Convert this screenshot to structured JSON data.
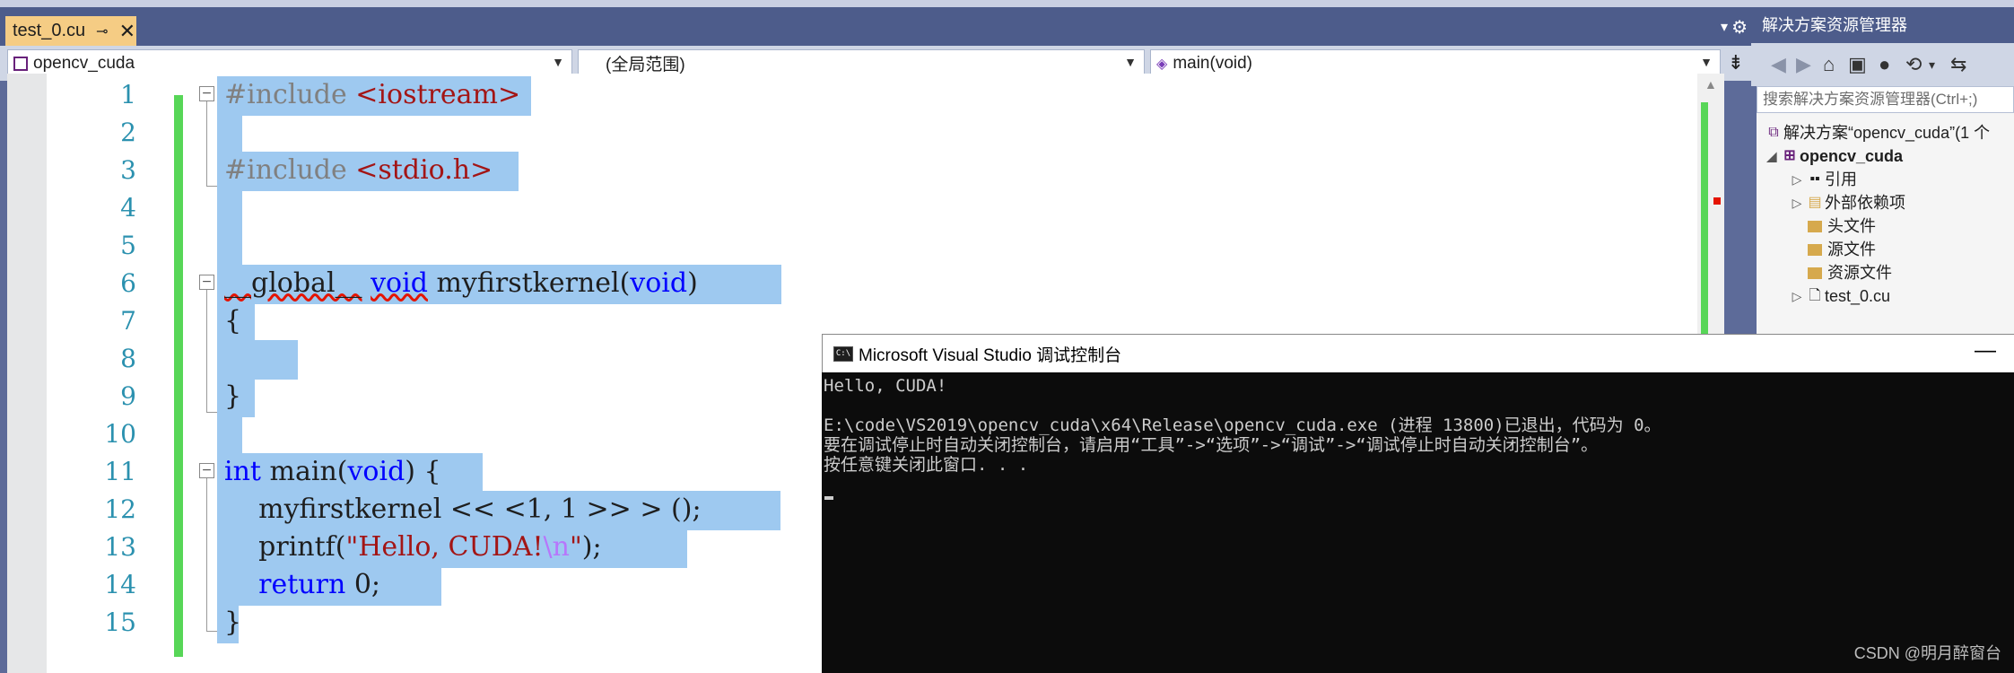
{
  "document_tab": {
    "title": "test_0.cu",
    "pin_icon": "pin-icon",
    "close": "✕"
  },
  "tabbar": {
    "dropdown": "▾",
    "settings": "⚙"
  },
  "navigation": {
    "project_combo": "opencv_cuda",
    "scope_combo": "(全局范围)",
    "member_combo": "main(void)",
    "split": "⇟"
  },
  "editor": {
    "line_numbers": [
      "1",
      "2",
      "3",
      "4",
      "5",
      "6",
      "7",
      "8",
      "9",
      "10",
      "11",
      "12",
      "13",
      "14",
      "15"
    ],
    "code": {
      "l1": {
        "pp": "#include",
        "str": " <iostream>"
      },
      "l3": {
        "pp": "#include",
        "str": " <stdio.h>"
      },
      "l6": {
        "global": "__global__",
        "sp": " ",
        "kw_void": "void",
        "name": " myfirstkernel(",
        "kw_void2": "void",
        "close": ")"
      },
      "l7": "{",
      "l9": "}",
      "l11": {
        "kw_int": "int",
        "rest": " main(",
        "kw_void": "void",
        "tail": ") {"
      },
      "l12": "    myfirstkernel << <1, 1 >> > ();",
      "l13": {
        "pre": "    printf(",
        "str": "\"Hello, CUDA!",
        "esc": "\\n",
        "str_end": "\"",
        "tail": ");"
      },
      "l14": {
        "kw": "return",
        "tail": " 0;"
      },
      "l15": "}"
    }
  },
  "solution_explorer": {
    "title": "解决方案资源管理器",
    "search_placeholder": "搜索解决方案资源管理器(Ctrl+;)",
    "tree": [
      {
        "label": "解决方案“opencv_cuda”(1 个",
        "icon": "solution-icon"
      },
      {
        "label": "opencv_cuda",
        "icon": "project-icon"
      },
      {
        "label": "引用",
        "icon": "references-icon"
      },
      {
        "label": "外部依赖项",
        "icon": "external-dependencies-icon"
      },
      {
        "label": "头文件",
        "icon": "folder-icon"
      },
      {
        "label": "源文件",
        "icon": "folder-icon"
      },
      {
        "label": "资源文件",
        "icon": "folder-icon"
      },
      {
        "label": "test_0.cu",
        "icon": "file-icon"
      }
    ]
  },
  "console": {
    "title": "Microsoft Visual Studio 调试控制台",
    "minimize": "—",
    "lines": [
      "Hello, CUDA!",
      "",
      "E:\\code\\VS2019\\opencv_cuda\\x64\\Release\\opencv_cuda.exe (进程 13800)已退出，代码为 0。",
      "要在调试停止时自动关闭控制台，请启用“工具”->“选项”->“调试”->“调试停止时自动关闭控制台”。",
      "按任意键关闭此窗口. . ."
    ]
  },
  "watermark": "CSDN @明月醉窗台",
  "colors": {
    "keyword": "#0000ff",
    "string": "#a31515",
    "preprocessor": "#808080",
    "escape": "#b776fb",
    "line_number": "#2b91af",
    "selection": "#9ec9f0",
    "change_bar": "#57d657",
    "active_tab": "#f5cc84",
    "frame": "#4d5c8b"
  }
}
